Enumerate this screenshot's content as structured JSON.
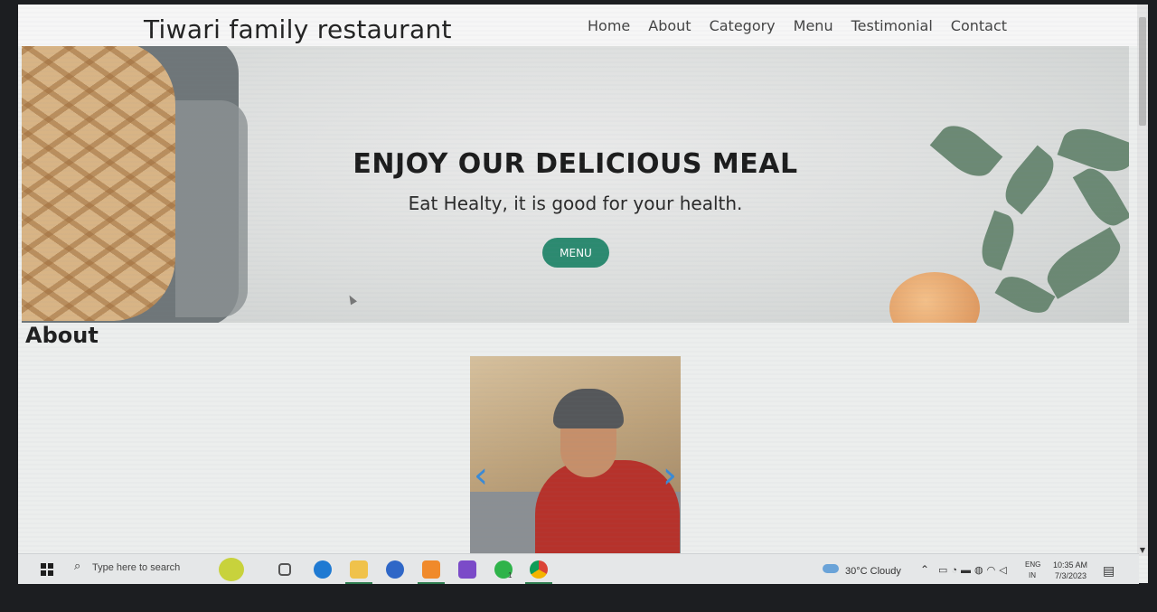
{
  "navbar": {
    "brand": "Tiwari family restaurant",
    "links": [
      "Home",
      "About",
      "Category",
      "Menu",
      "Testimonial",
      "Contact"
    ]
  },
  "hero": {
    "title": "ENJOY OUR DELICIOUS MEAL",
    "subtitle": "Eat Healty, it is good for your health.",
    "button": "MENU",
    "accent": "#2c8a70"
  },
  "about": {
    "title": "About",
    "carousel_prev": "‹",
    "carousel_next": "›"
  },
  "taskbar": {
    "search_placeholder": "Type here to search",
    "weather": "30°C  Cloudy",
    "language_top": "ENG",
    "language_bottom": "IN",
    "time": "10:35 AM",
    "date": "7/3/2023",
    "apps": [
      "task-view-icon",
      "edge-icon",
      "file-explorer-icon",
      "app-icon",
      "sublime-icon",
      "visual-studio-icon",
      "whatsapp-icon",
      "chrome-icon"
    ],
    "whatsapp_badge": "1"
  }
}
